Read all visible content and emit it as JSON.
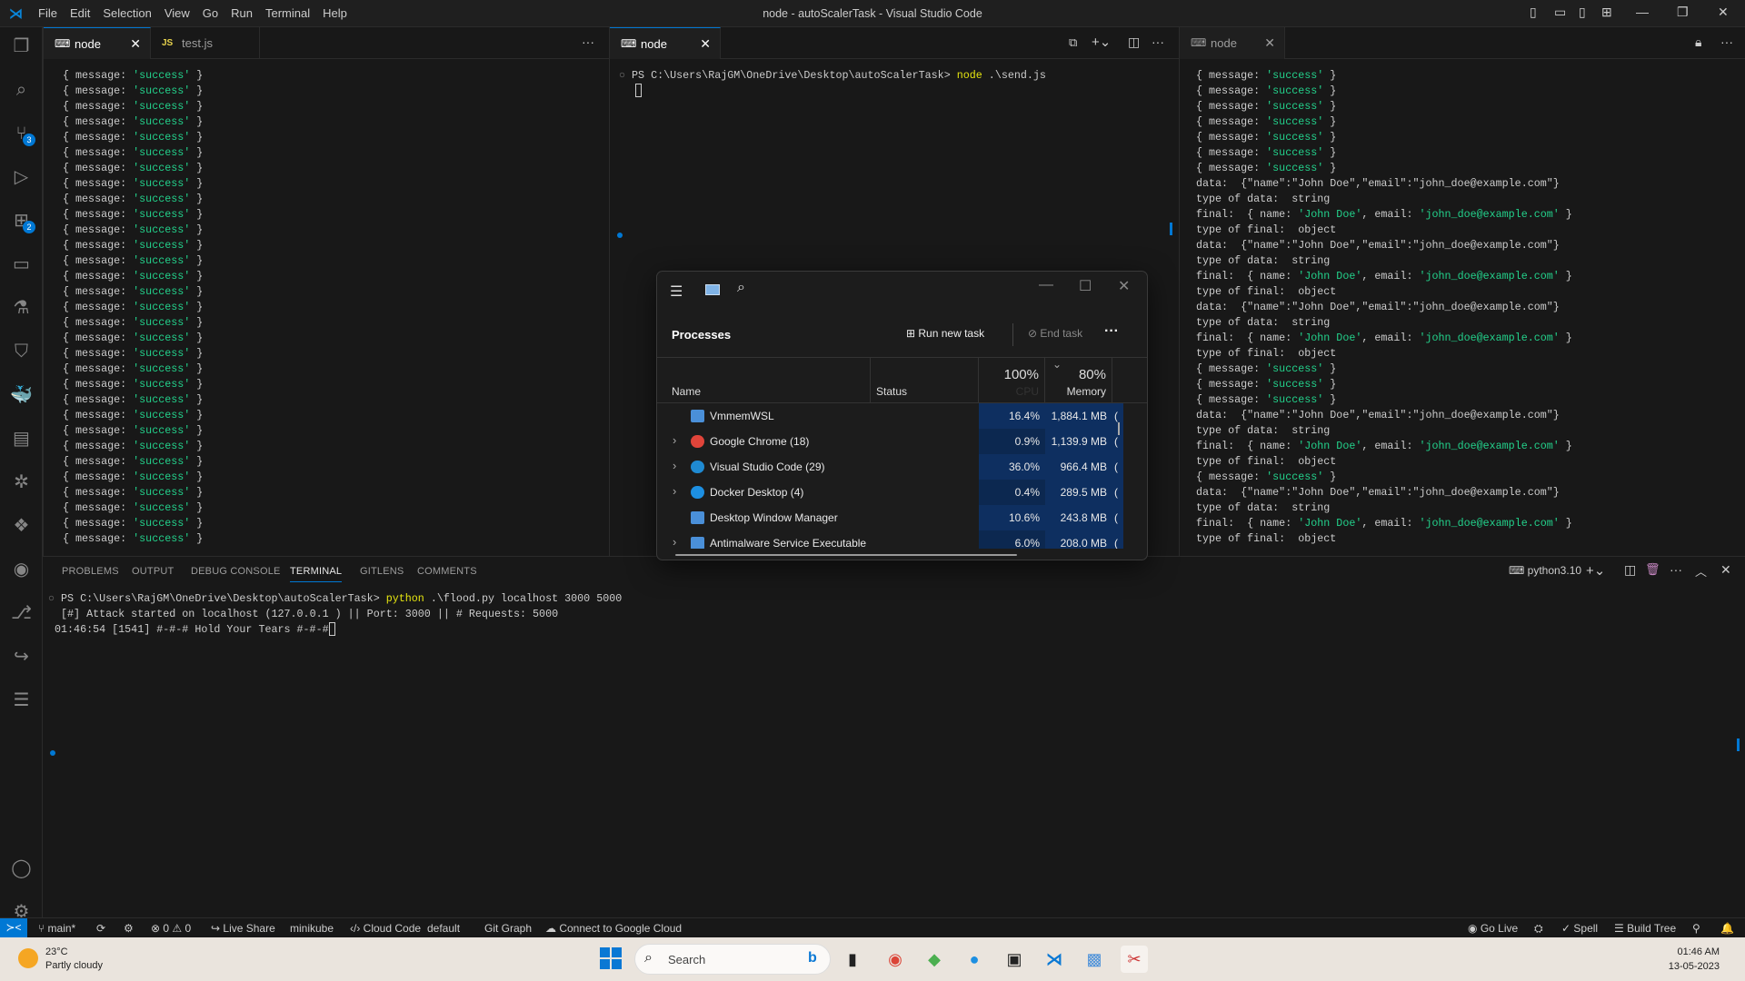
{
  "window": {
    "title": "node - autoScalerTask - Visual Studio Code",
    "menu": [
      "File",
      "Edit",
      "Selection",
      "View",
      "Go",
      "Run",
      "Terminal",
      "Help"
    ]
  },
  "activity": {
    "items": [
      {
        "icon": "files-icon",
        "glyph": "❐"
      },
      {
        "icon": "search-icon",
        "glyph": "⌕"
      },
      {
        "icon": "source-control-icon",
        "glyph": "⑂",
        "badge": "3"
      },
      {
        "icon": "run-debug-icon",
        "glyph": "▷"
      },
      {
        "icon": "extensions-icon",
        "glyph": "⊞",
        "badge": "2"
      },
      {
        "icon": "remote-explorer-icon",
        "glyph": "▭"
      },
      {
        "icon": "testing-icon",
        "glyph": "⚗"
      },
      {
        "icon": "bookmark-icon",
        "glyph": "⛉"
      },
      {
        "icon": "docker-icon",
        "glyph": "🐳"
      },
      {
        "icon": "api-icon",
        "glyph": "▤"
      },
      {
        "icon": "kubernetes-icon",
        "glyph": "✲"
      },
      {
        "icon": "gitlens-icon",
        "glyph": "❖"
      },
      {
        "icon": "github-icon",
        "glyph": "◉"
      },
      {
        "icon": "git-graph-icon",
        "glyph": "⎇"
      },
      {
        "icon": "live-share-icon",
        "glyph": "↪"
      },
      {
        "icon": "outline-icon",
        "glyph": "☰"
      }
    ],
    "bottom": [
      {
        "icon": "account-icon",
        "glyph": "◯"
      },
      {
        "icon": "settings-icon",
        "glyph": "⚙"
      }
    ]
  },
  "group1": {
    "tabs": [
      {
        "label": "node",
        "icon": "terminal-icon",
        "active": true
      },
      {
        "label": "test.js",
        "icon": "js-file-icon",
        "active": false
      }
    ],
    "lines_count_label": "",
    "success_line": "{ message: 'success' }",
    "repeat": 31
  },
  "group2": {
    "tabs": [
      {
        "label": "node",
        "icon": "terminal-icon",
        "active": true
      }
    ],
    "prompt": "PS C:\\Users\\RajGM\\OneDrive\\Desktop\\autoScalerTask> ",
    "command": "node",
    ".args": "",
    "args": " .\\send.js"
  },
  "group3": {
    "tabs": [
      {
        "label": "node",
        "icon": "terminal-icon",
        "active": false
      }
    ],
    "lines": [
      "{ message: 'success' }",
      "{ message: 'success' }",
      "{ message: 'success' }",
      "{ message: 'success' }",
      "{ message: 'success' }",
      "{ message: 'success' }",
      "{ message: 'success' }",
      "data:  {\"name\":\"John Doe\",\"email\":\"john_doe@example.com\"}",
      "type of data:  string",
      "final:  { name: 'John Doe', email: 'john_doe@example.com' }",
      "type of final:  object",
      "data:  {\"name\":\"John Doe\",\"email\":\"john_doe@example.com\"}",
      "type of data:  string",
      "final:  { name: 'John Doe', email: 'john_doe@example.com' }",
      "type of final:  object",
      "data:  {\"name\":\"John Doe\",\"email\":\"john_doe@example.com\"}",
      "type of data:  string",
      "final:  { name: 'John Doe', email: 'john_doe@example.com' }",
      "type of final:  object",
      "{ message: 'success' }",
      "{ message: 'success' }",
      "{ message: 'success' }",
      "data:  {\"name\":\"John Doe\",\"email\":\"john_doe@example.com\"}",
      "type of data:  string",
      "final:  { name: 'John Doe', email: 'john_doe@example.com' }",
      "type of final:  object",
      "{ message: 'success' }",
      "data:  {\"name\":\"John Doe\",\"email\":\"john_doe@example.com\"}",
      "type of data:  string",
      "final:  { name: 'John Doe', email: 'john_doe@example.com' }",
      "type of final:  object"
    ]
  },
  "panel": {
    "tabs": [
      "PROBLEMS",
      "OUTPUT",
      "DEBUG CONSOLE",
      "TERMINAL",
      "GITLENS",
      "COMMENTS"
    ],
    "active_tab": "TERMINAL",
    "shell": "python3.10",
    "prompt": "PS C:\\Users\\RajGM\\OneDrive\\Desktop\\autoScalerTask> ",
    "command": "python",
    "args": " .\\flood.py localhost 3000 5000",
    "output": [
      "[#] Attack started on localhost (127.0.0.1 ) || Port: 3000 || # Requests: 5000",
      " 01:46:54 [1541] #-#-# Hold Your Tears #-#-#"
    ]
  },
  "task_manager": {
    "title": "Processes",
    "run_new_task": "Run new task",
    "end_task": "End task",
    "columns": {
      "name": "Name",
      "status": "Status",
      "cpu_pct": "100%",
      "cpu": "CPU",
      "mem_pct": "80%",
      "memory": "Memory"
    },
    "rows": [
      {
        "name": "VmmemWSL",
        "cpu": "16.4%",
        "memory": "1,884.1 MB",
        "expand": false,
        "icon": "window-icon"
      },
      {
        "name": "Google Chrome (18)",
        "cpu": "0.9%",
        "memory": "1,139.9 MB",
        "expand": true,
        "icon": "chrome-icon"
      },
      {
        "name": "Visual Studio Code (29)",
        "cpu": "36.0%",
        "memory": "966.4 MB",
        "expand": true,
        "icon": "vscode-icon"
      },
      {
        "name": "Docker Desktop (4)",
        "cpu": "0.4%",
        "memory": "289.5 MB",
        "expand": true,
        "icon": "docker-icon"
      },
      {
        "name": "Desktop Window Manager",
        "cpu": "10.6%",
        "memory": "243.8 MB",
        "expand": false,
        "icon": "window-icon"
      },
      {
        "name": "Antimalware Service Executable",
        "cpu": "6.0%",
        "memory": "208.0 MB",
        "expand": true,
        "icon": "window-icon"
      }
    ]
  },
  "status": {
    "left": [
      "main*",
      "⟳",
      "⚙",
      "⊗ 0 ⚠ 0",
      "Live Share",
      "minikube",
      "Cloud Code",
      "default",
      "Git Graph",
      "Connect to Google Cloud"
    ],
    "right": [
      "Go Live",
      "⛭",
      "✓ Spell",
      "☰ Build Tree",
      "⚲",
      "🔔"
    ]
  },
  "taskbar": {
    "weather_temp": "23°C",
    "weather_desc": "Partly cloudy",
    "search": "Search",
    "time": "01:46 AM",
    "date": "13-05-2023"
  },
  "colors": {
    "accent": "#0078d4",
    "string_green": "#23d18b",
    "command_yellow": "#e5e510",
    "tm_highlight": "#0e2d5c"
  }
}
